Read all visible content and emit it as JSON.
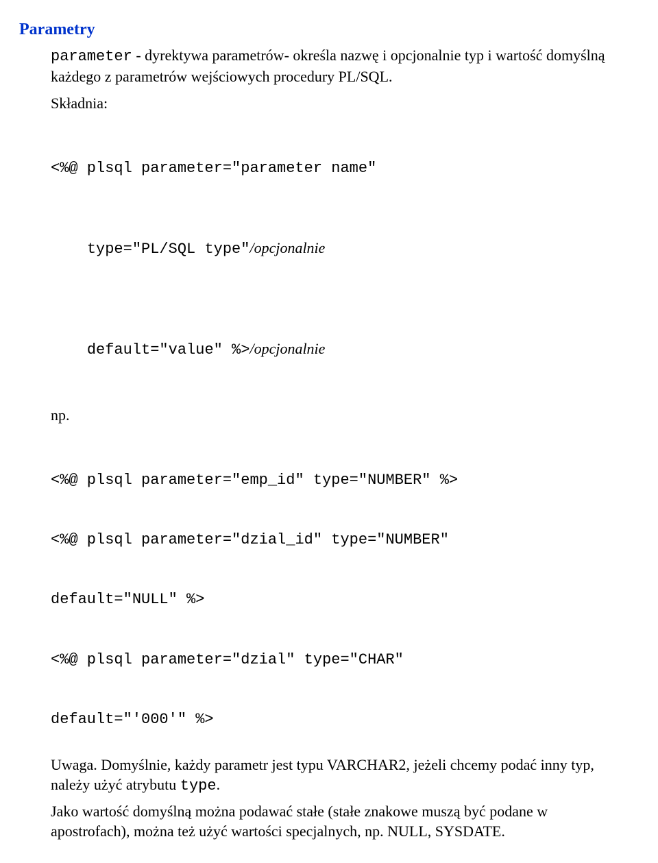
{
  "title": "Parametry",
  "intro": {
    "lead_mono": "parameter",
    "lead_text": " - dyrektywa parametrów- określa nazwę i opcjonalnie typ i wartość domyślną każdego z parametrów wejściowych procedury PL/SQL."
  },
  "syntax": {
    "label": "Składnia:",
    "line1a": "<%@ plsql parameter=\"parameter name\"",
    "line2_monoA": "type=\"PL/SQL type\"",
    "line2_italic": "/opcjonalnie",
    "line3_mono": "default=\"value\" %>",
    "line3_italic": "/opcjonalnie"
  },
  "np_label": "np.",
  "code": {
    "l1": "<%@ plsql parameter=\"emp_id\" type=\"NUMBER\" %>",
    "l2": "<%@ plsql parameter=\"dzial_id\" type=\"NUMBER\"",
    "l3": "default=\"NULL\" %>",
    "l4": "<%@ plsql parameter=\"dzial\" type=\"CHAR\"",
    "l5": "default=\"'000'\" %>"
  },
  "note": {
    "p1a": "Uwaga. Domyślnie, każdy parametr jest typu VARCHAR2, jeżeli chcemy podać inny typ, należy użyć atrybutu ",
    "p1_mono": "type",
    "p1b": ".",
    "p2": "Jako wartość domyślną można podawać stałe (stałe znakowe muszą być podane w apostrofach), można też użyć wartości specjalnych, np. NULL, SYSDATE."
  }
}
